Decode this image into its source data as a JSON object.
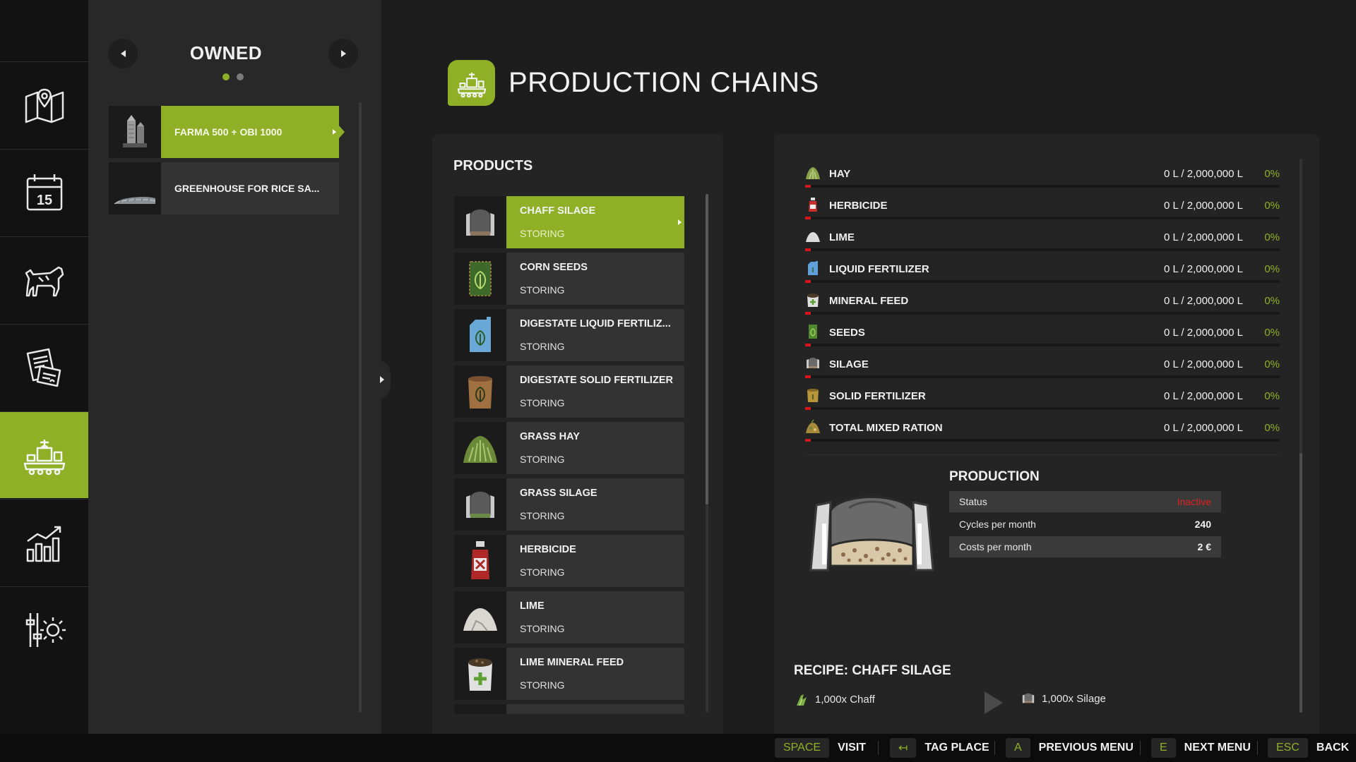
{
  "owned": {
    "title": "OWNED",
    "items": [
      {
        "label": "FARMA 500 + OBI 1000",
        "active": true
      },
      {
        "label": "GREENHOUSE FOR RICE SA...",
        "active": false
      }
    ]
  },
  "header": {
    "title": "PRODUCTION CHAINS"
  },
  "products": {
    "title": "PRODUCTS",
    "items": [
      {
        "name": "CHAFF SILAGE",
        "status": "STORING",
        "icon": "silage-icon"
      },
      {
        "name": "CORN SEEDS",
        "status": "STORING",
        "icon": "seeds-bag-icon"
      },
      {
        "name": "DIGESTATE LIQUID FERTILIZ...",
        "status": "STORING",
        "icon": "liquid-fertilizer-icon"
      },
      {
        "name": "DIGESTATE SOLID FERTILIZER",
        "status": "STORING",
        "icon": "solid-fertilizer-icon"
      },
      {
        "name": "GRASS HAY",
        "status": "STORING",
        "icon": "hay-icon"
      },
      {
        "name": "GRASS SILAGE",
        "status": "STORING",
        "icon": "silage-icon"
      },
      {
        "name": "HERBICIDE",
        "status": "STORING",
        "icon": "herbicide-icon"
      },
      {
        "name": "LIME",
        "status": "STORING",
        "icon": "lime-icon"
      },
      {
        "name": "LIME MINERAL FEED",
        "status": "STORING",
        "icon": "mineral-feed-icon"
      }
    ]
  },
  "storage": [
    {
      "name": "HAY",
      "amount": "0 L / 2,000,000 L",
      "pct": "0%",
      "fill": 0,
      "color": "#8aa04a"
    },
    {
      "name": "HERBICIDE",
      "amount": "0 L / 2,000,000 L",
      "pct": "0%",
      "fill": 0,
      "color": "#c9302c"
    },
    {
      "name": "LIME",
      "amount": "0 L / 2,000,000 L",
      "pct": "0%",
      "fill": 0,
      "color": "#d8d8d8"
    },
    {
      "name": "LIQUID FERTILIZER",
      "amount": "0 L / 2,000,000 L",
      "pct": "0%",
      "fill": 0,
      "color": "#5fa0d8"
    },
    {
      "name": "MINERAL FEED",
      "amount": "0 L / 2,000,000 L",
      "pct": "0%",
      "fill": 0,
      "color": "#e0e0e0"
    },
    {
      "name": "SEEDS",
      "amount": "0 L / 2,000,000 L",
      "pct": "0%",
      "fill": 0,
      "color": "#6cae3a"
    },
    {
      "name": "SILAGE",
      "amount": "0 L / 2,000,000 L",
      "pct": "0%",
      "fill": 0,
      "color": "#9a9a9a"
    },
    {
      "name": "SOLID FERTILIZER",
      "amount": "0 L / 2,000,000 L",
      "pct": "0%",
      "fill": 0,
      "color": "#b8953a"
    },
    {
      "name": "TOTAL MIXED RATION",
      "amount": "0 L / 2,000,000 L",
      "pct": "0%",
      "fill": 0,
      "color": "#a8893a"
    }
  ],
  "production": {
    "title": "PRODUCTION",
    "status_label": "Status",
    "status_value": "Inactive",
    "cycles_label": "Cycles per month",
    "cycles_value": "240",
    "costs_label": "Costs per month",
    "costs_value": "2 €"
  },
  "recipe": {
    "title": "RECIPE: CHAFF SILAGE",
    "input": "1,000x Chaff",
    "output": "1,000x Silage"
  },
  "footer": {
    "hints": [
      {
        "key": "SPACE",
        "label": "VISIT"
      },
      {
        "key": "↤",
        "label": "TAG PLACE"
      },
      {
        "key": "A",
        "label": "PREVIOUS MENU"
      },
      {
        "key": "E",
        "label": "NEXT MENU"
      },
      {
        "key": "ESC",
        "label": "BACK"
      }
    ]
  },
  "colors": {
    "accent": "#8fb026",
    "alert": "#e02020"
  }
}
